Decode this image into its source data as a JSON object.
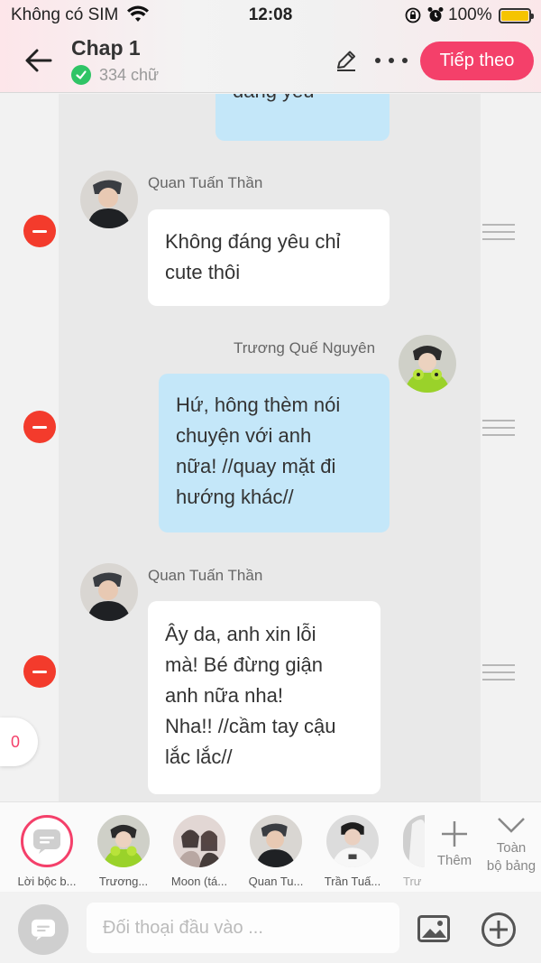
{
  "status": {
    "carrier": "Không có SIM",
    "time": "12:08",
    "battery": "100%"
  },
  "header": {
    "title": "Chap 1",
    "word_count": "334 chữ",
    "next_label": "Tiếp theo"
  },
  "colors": {
    "accent": "#f4406a",
    "bubble_blue": "#c4e7f9",
    "bubble_white": "#ffffff",
    "remove": "#f33b2c",
    "check": "#2fc466"
  },
  "messages": [
    {
      "side": "right",
      "name": "",
      "lines": [
        "đáng yêu"
      ]
    },
    {
      "side": "left",
      "name": "Quan Tuấn Thần",
      "lines": [
        "Không đáng yêu chỉ",
        "cute thôi"
      ]
    },
    {
      "side": "right",
      "name": "Trương Quế Nguyên",
      "lines": [
        "Hứ, hông thèm nói",
        "chuyện với anh",
        "nữa! //quay mặt đi",
        "hướng khác//"
      ]
    },
    {
      "side": "left",
      "name": "Quan Tuấn Thần",
      "lines": [
        "Ây da, anh xin lỗi",
        "mà! Bé đừng giận",
        "anh nữa nha!",
        "Nha!! //cầm tay cậu",
        "lắc lắc//"
      ]
    }
  ],
  "side_counter": "0",
  "characters": [
    {
      "label": "Lời bộc b...",
      "icon": "narration-icon"
    },
    {
      "label": "Trương..."
    },
    {
      "label": "Moon (tá..."
    },
    {
      "label": "Quan Tu..."
    },
    {
      "label": "Trần Tuấ..."
    },
    {
      "label": "Trư"
    }
  ],
  "add_character_label": "Thêm",
  "all_board_label": [
    "Toàn",
    "bộ bảng"
  ],
  "input": {
    "placeholder": "Đối thoại đầu vào ..."
  },
  "icons": [
    "back-arrow-icon",
    "checkmark-icon",
    "pencil-icon",
    "more-icon",
    "image-icon",
    "plus-circle-icon",
    "chevron-down-icon",
    "plus-icon",
    "drag-handle-icon",
    "remove-icon"
  ]
}
